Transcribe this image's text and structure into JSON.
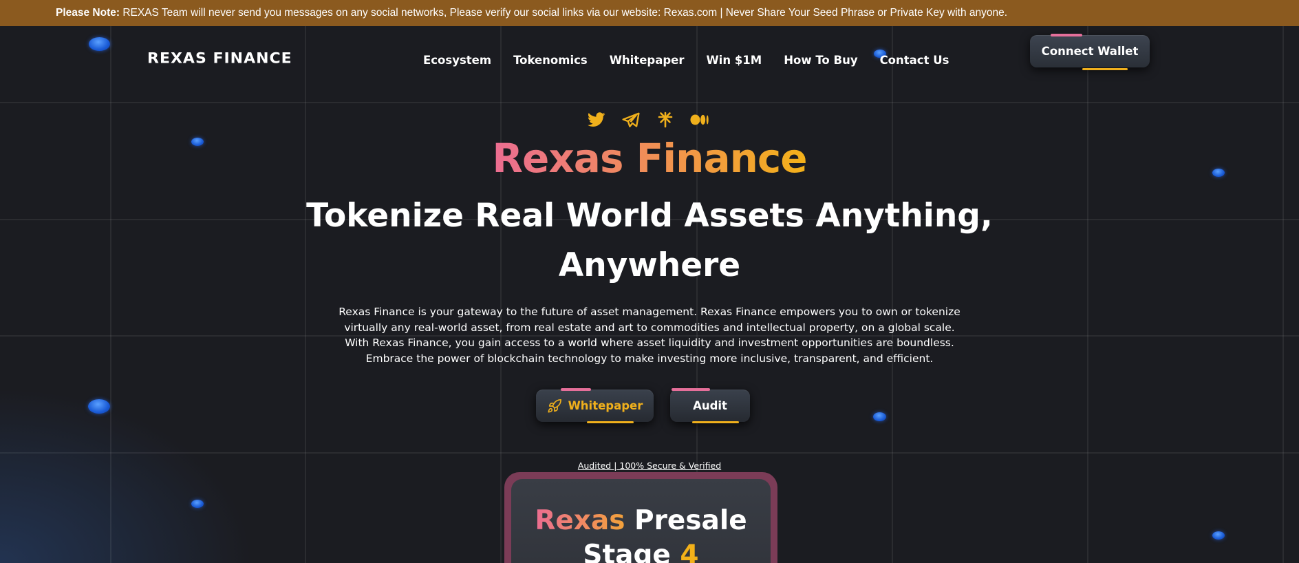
{
  "notice": {
    "label": "Please Note:",
    "text": " REXAS Team will never send you messages on any social networks, Please verify our social links via our website: Rexas.com | Never Share Your Seed Phrase or Private Key with anyone."
  },
  "header": {
    "logo": "REXAS FINANCE",
    "nav": [
      "Ecosystem",
      "Tokenomics",
      "Whitepaper",
      "Win $1M",
      "How To Buy",
      "Contact Us"
    ],
    "connect_label": "Connect Wallet"
  },
  "socials": [
    "twitter-icon",
    "telegram-icon",
    "linktree-icon",
    "medium-icon"
  ],
  "colors": {
    "accent_pink": "#ec6d92",
    "accent_orange": "#f3b119",
    "notice_bg": "#8b5a1f",
    "background": "#1b1c21"
  },
  "hero": {
    "title": "Rexas Finance",
    "subtitle_line1": "Tokenize Real World Assets Anything,",
    "subtitle_line2": "Anywhere",
    "description_lines": [
      "Rexas Finance is your gateway to the future of asset management. Rexas Finance empowers you to own or tokenize",
      "virtually any real-world asset, from real estate and art to commodities and intellectual property, on a global scale.",
      "With Rexas Finance, you gain access to a world where asset liquidity and investment opportunities are boundless.",
      "Embrace the power of blockchain technology to make investing more inclusive, transparent, and efficient."
    ],
    "whitepaper_label": "Whitepaper",
    "audit_label": "Audit",
    "audited_text": "Audited | 100% Secure & Verified"
  },
  "presale": {
    "brand": "Rexas",
    "word": " Presale",
    "stage_label": "Stage ",
    "stage_number": "4"
  }
}
